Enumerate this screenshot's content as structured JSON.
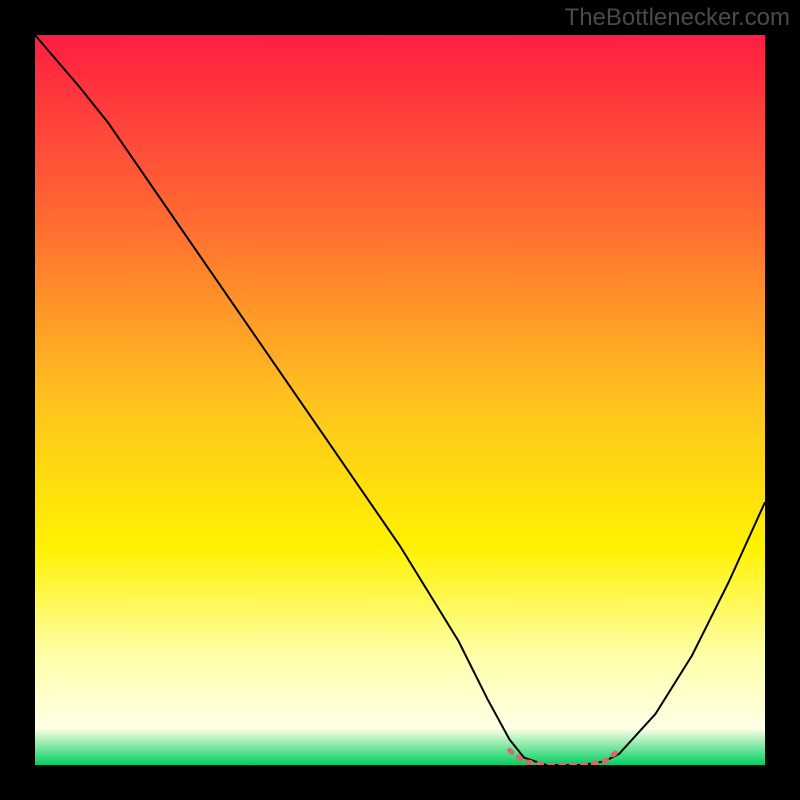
{
  "watermark": "TheBottlenecker.com",
  "chart_data": {
    "type": "line",
    "title": "",
    "xlabel": "",
    "ylabel": "",
    "xlim": [
      0,
      100
    ],
    "ylim": [
      0,
      100
    ],
    "background_gradient": {
      "direction": "vertical",
      "stops": [
        {
          "offset": 0,
          "color": "#ff1e42"
        },
        {
          "offset": 25,
          "color": "#ff6a32"
        },
        {
          "offset": 50,
          "color": "#ffc21f"
        },
        {
          "offset": 70,
          "color": "#fff200"
        },
        {
          "offset": 85,
          "color": "#ffffaa"
        },
        {
          "offset": 95,
          "color": "#ffffe6"
        },
        {
          "offset": 100,
          "color": "#00d060"
        }
      ]
    },
    "series": [
      {
        "name": "bottleneck-curve",
        "color": "#000000",
        "stroke_width": 2,
        "points": [
          {
            "x": 0,
            "y": 100
          },
          {
            "x": 6,
            "y": 93
          },
          {
            "x": 10,
            "y": 88
          },
          {
            "x": 20,
            "y": 73.5
          },
          {
            "x": 30,
            "y": 59
          },
          {
            "x": 40,
            "y": 44.5
          },
          {
            "x": 50,
            "y": 30
          },
          {
            "x": 58,
            "y": 17
          },
          {
            "x": 62,
            "y": 9
          },
          {
            "x": 65,
            "y": 3.5
          },
          {
            "x": 67,
            "y": 1
          },
          {
            "x": 70,
            "y": 0
          },
          {
            "x": 75,
            "y": 0
          },
          {
            "x": 78,
            "y": 0.5
          },
          {
            "x": 80,
            "y": 1.5
          },
          {
            "x": 85,
            "y": 7
          },
          {
            "x": 90,
            "y": 15
          },
          {
            "x": 95,
            "y": 25
          },
          {
            "x": 100,
            "y": 36
          }
        ]
      },
      {
        "name": "optimal-zone-marker",
        "color": "#d46a6a",
        "stroke_width": 5,
        "points": [
          {
            "x": 65,
            "y": 2
          },
          {
            "x": 67,
            "y": 0.5
          },
          {
            "x": 70,
            "y": 0
          },
          {
            "x": 75,
            "y": 0
          },
          {
            "x": 78,
            "y": 0.5
          },
          {
            "x": 80,
            "y": 2
          }
        ]
      }
    ]
  }
}
